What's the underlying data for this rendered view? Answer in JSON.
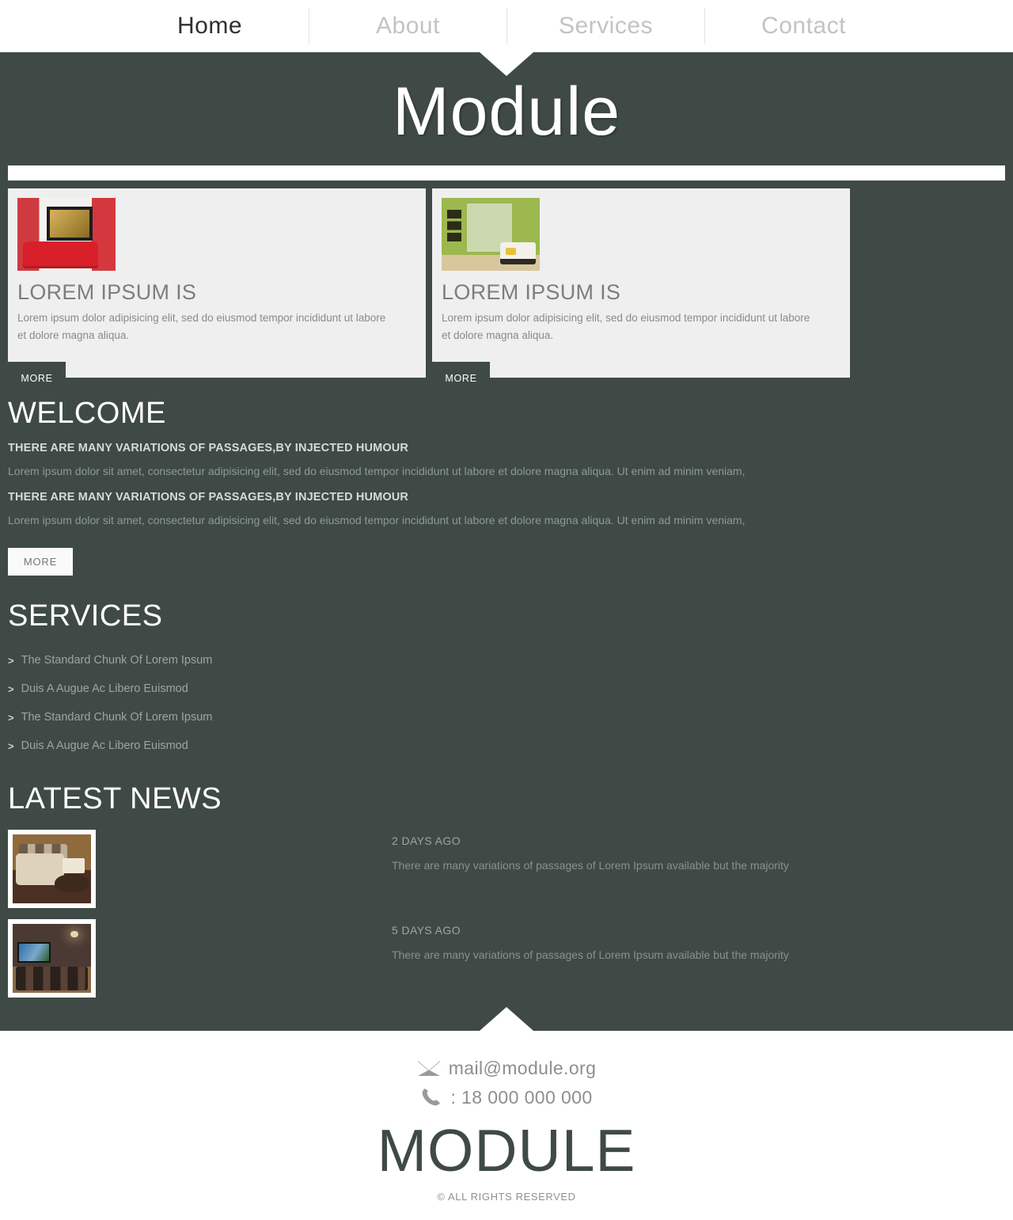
{
  "nav": {
    "items": [
      {
        "label": "Home",
        "active": true
      },
      {
        "label": "About",
        "active": false
      },
      {
        "label": "Services",
        "active": false
      },
      {
        "label": "Contact",
        "active": false
      }
    ]
  },
  "header": {
    "title": "Module"
  },
  "cards": [
    {
      "image_name": "red-living-room-thumbnail",
      "title": "LOREM IPSUM IS",
      "text": "Lorem ipsum dolor adipisicing elit, sed do eiusmod tempor incididunt ut labore et dolore magna aliqua.",
      "more_label": "MORE"
    },
    {
      "image_name": "green-living-room-thumbnail",
      "title": "LOREM IPSUM IS",
      "text": "Lorem ipsum dolor adipisicing elit, sed do eiusmod tempor incididunt ut labore et dolore magna aliqua.",
      "more_label": "MORE"
    }
  ],
  "welcome": {
    "title": "WELCOME",
    "blocks": [
      {
        "subhead": "THERE ARE MANY VARIATIONS OF PASSAGES,BY INJECTED HUMOUR",
        "paragraph": "Lorem ipsum dolor sit amet, consectetur adipisicing elit, sed do eiusmod tempor incididunt ut labore et dolore magna aliqua. Ut enim ad minim veniam,"
      },
      {
        "subhead": "THERE ARE MANY VARIATIONS OF PASSAGES,BY INJECTED HUMOUR",
        "paragraph": "Lorem ipsum dolor sit amet, consectetur adipisicing elit, sed do eiusmod tempor incididunt ut labore et dolore magna aliqua. Ut enim ad minim veniam,"
      }
    ],
    "more_label": "MORE"
  },
  "services": {
    "title": "SERVICES",
    "arrow": ">",
    "items": [
      "The Standard Chunk Of Lorem Ipsum",
      "Duis A Augue Ac Libero Euismod",
      "The Standard Chunk Of Lorem Ipsum",
      "Duis A Augue Ac Libero Euismod"
    ]
  },
  "news": {
    "title": "LATEST NEWS",
    "items": [
      {
        "image_name": "living-room-sofa-thumbnail",
        "date": "2 DAYS AGO",
        "text": "There are many variations of passages of Lorem Ipsum available but the majority"
      },
      {
        "image_name": "home-theater-thumbnail",
        "date": "5 DAYS AGO",
        "text": "There are many variations of passages of Lorem Ipsum available but the majority"
      }
    ]
  },
  "footer": {
    "email": "mail@module.org",
    "phone": ": 18 000 000 000",
    "brand": "MODULE",
    "copyright": "© ALL RIGHTS RESERVED"
  },
  "colors": {
    "page_background": "#3f4a46",
    "card_background": "#efefef",
    "white": "#ffffff",
    "nav_active": "#2f2f2f",
    "nav_inactive": "#c3c3c3"
  }
}
